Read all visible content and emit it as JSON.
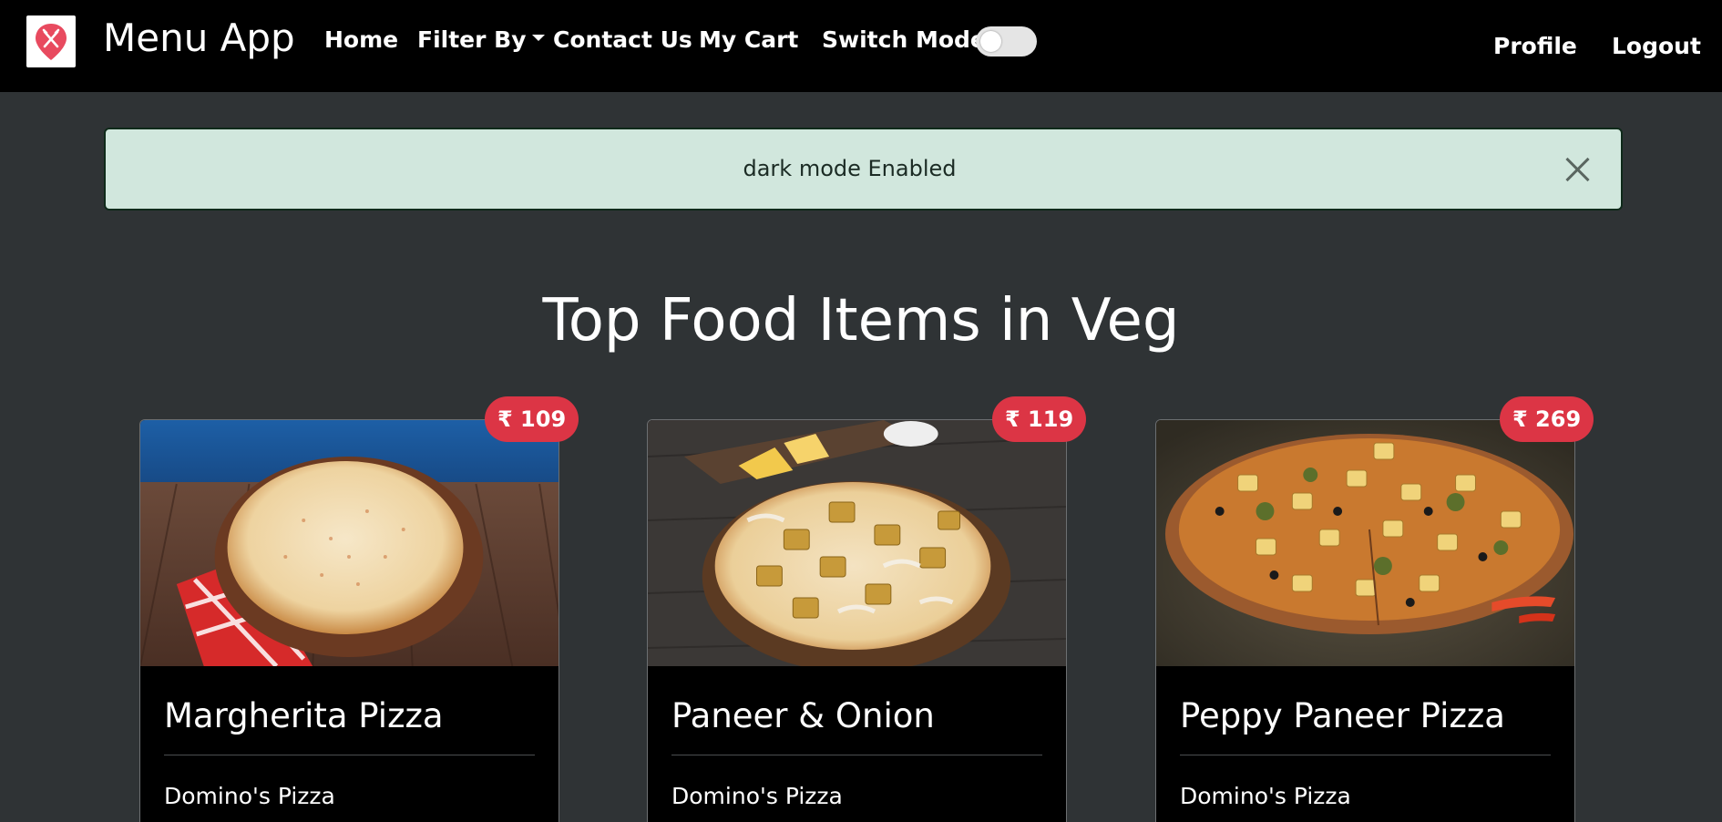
{
  "navbar": {
    "brand": "Menu App",
    "links": {
      "home": "Home",
      "filter_by": "Filter By",
      "contact_us": "Contact Us",
      "my_cart": "My Cart",
      "switch_mode": "Switch Mode",
      "profile": "Profile",
      "logout": "Logout"
    },
    "switch_mode_on": false,
    "logo_icon": "restaurant-pin-icon",
    "accent_color": "#e84a5f"
  },
  "alert": {
    "message": "dark mode Enabled",
    "close_icon": "close-icon",
    "background_color": "#d1e7dd"
  },
  "heading": "Top Food Items in Veg",
  "cards": [
    {
      "title": "Margherita Pizza",
      "restaurant": "Domino's Pizza",
      "price": "₹ 109"
    },
    {
      "title": "Paneer & Onion",
      "restaurant": "Domino's Pizza",
      "price": "₹ 119"
    },
    {
      "title": "Peppy Paneer Pizza",
      "restaurant": "Domino's Pizza",
      "price": "₹ 269"
    }
  ],
  "badge_color": "#dc3545"
}
